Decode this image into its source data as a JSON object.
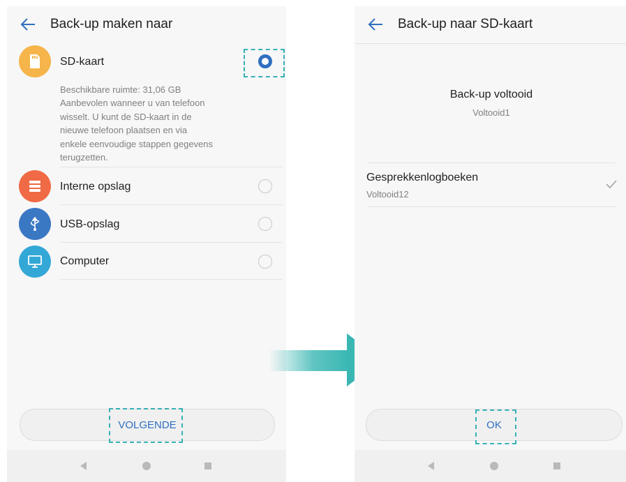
{
  "left": {
    "title": "Back-up maken naar",
    "options": [
      {
        "label": "SD-kaart",
        "icon": "sd-card-icon",
        "color": "#f5b54a",
        "selected": true
      },
      {
        "label": "Interne opslag",
        "icon": "storage-icon",
        "color": "#f06a45",
        "selected": false
      },
      {
        "label": "USB-opslag",
        "icon": "usb-icon",
        "color": "#3b78c4",
        "selected": false
      },
      {
        "label": "Computer",
        "icon": "monitor-icon",
        "color": "#33a8d6",
        "selected": false
      }
    ],
    "sd_space": "Beschikbare ruimte: 31,06 GB",
    "sd_desc": [
      "Aanbevolen wanneer u van telefoon",
      "wisselt. U kunt de SD-kaart in de",
      "nieuwe telefoon plaatsen en via",
      "enkele eenvoudige stappen gegevens",
      "terugzetten."
    ],
    "next_button": "VOLGENDE"
  },
  "right": {
    "title": "Back-up naar SD-kaart",
    "status_title": "Back-up voltooid",
    "status_sub": "Voltooid1",
    "item_title": "Gesprekkenlogboeken",
    "item_sub": "Voltooid12",
    "ok_button": "OK"
  },
  "colors": {
    "accent": "#2f6fc0",
    "highlight": "#36b1b5",
    "arrow": "#3ab7b3"
  }
}
